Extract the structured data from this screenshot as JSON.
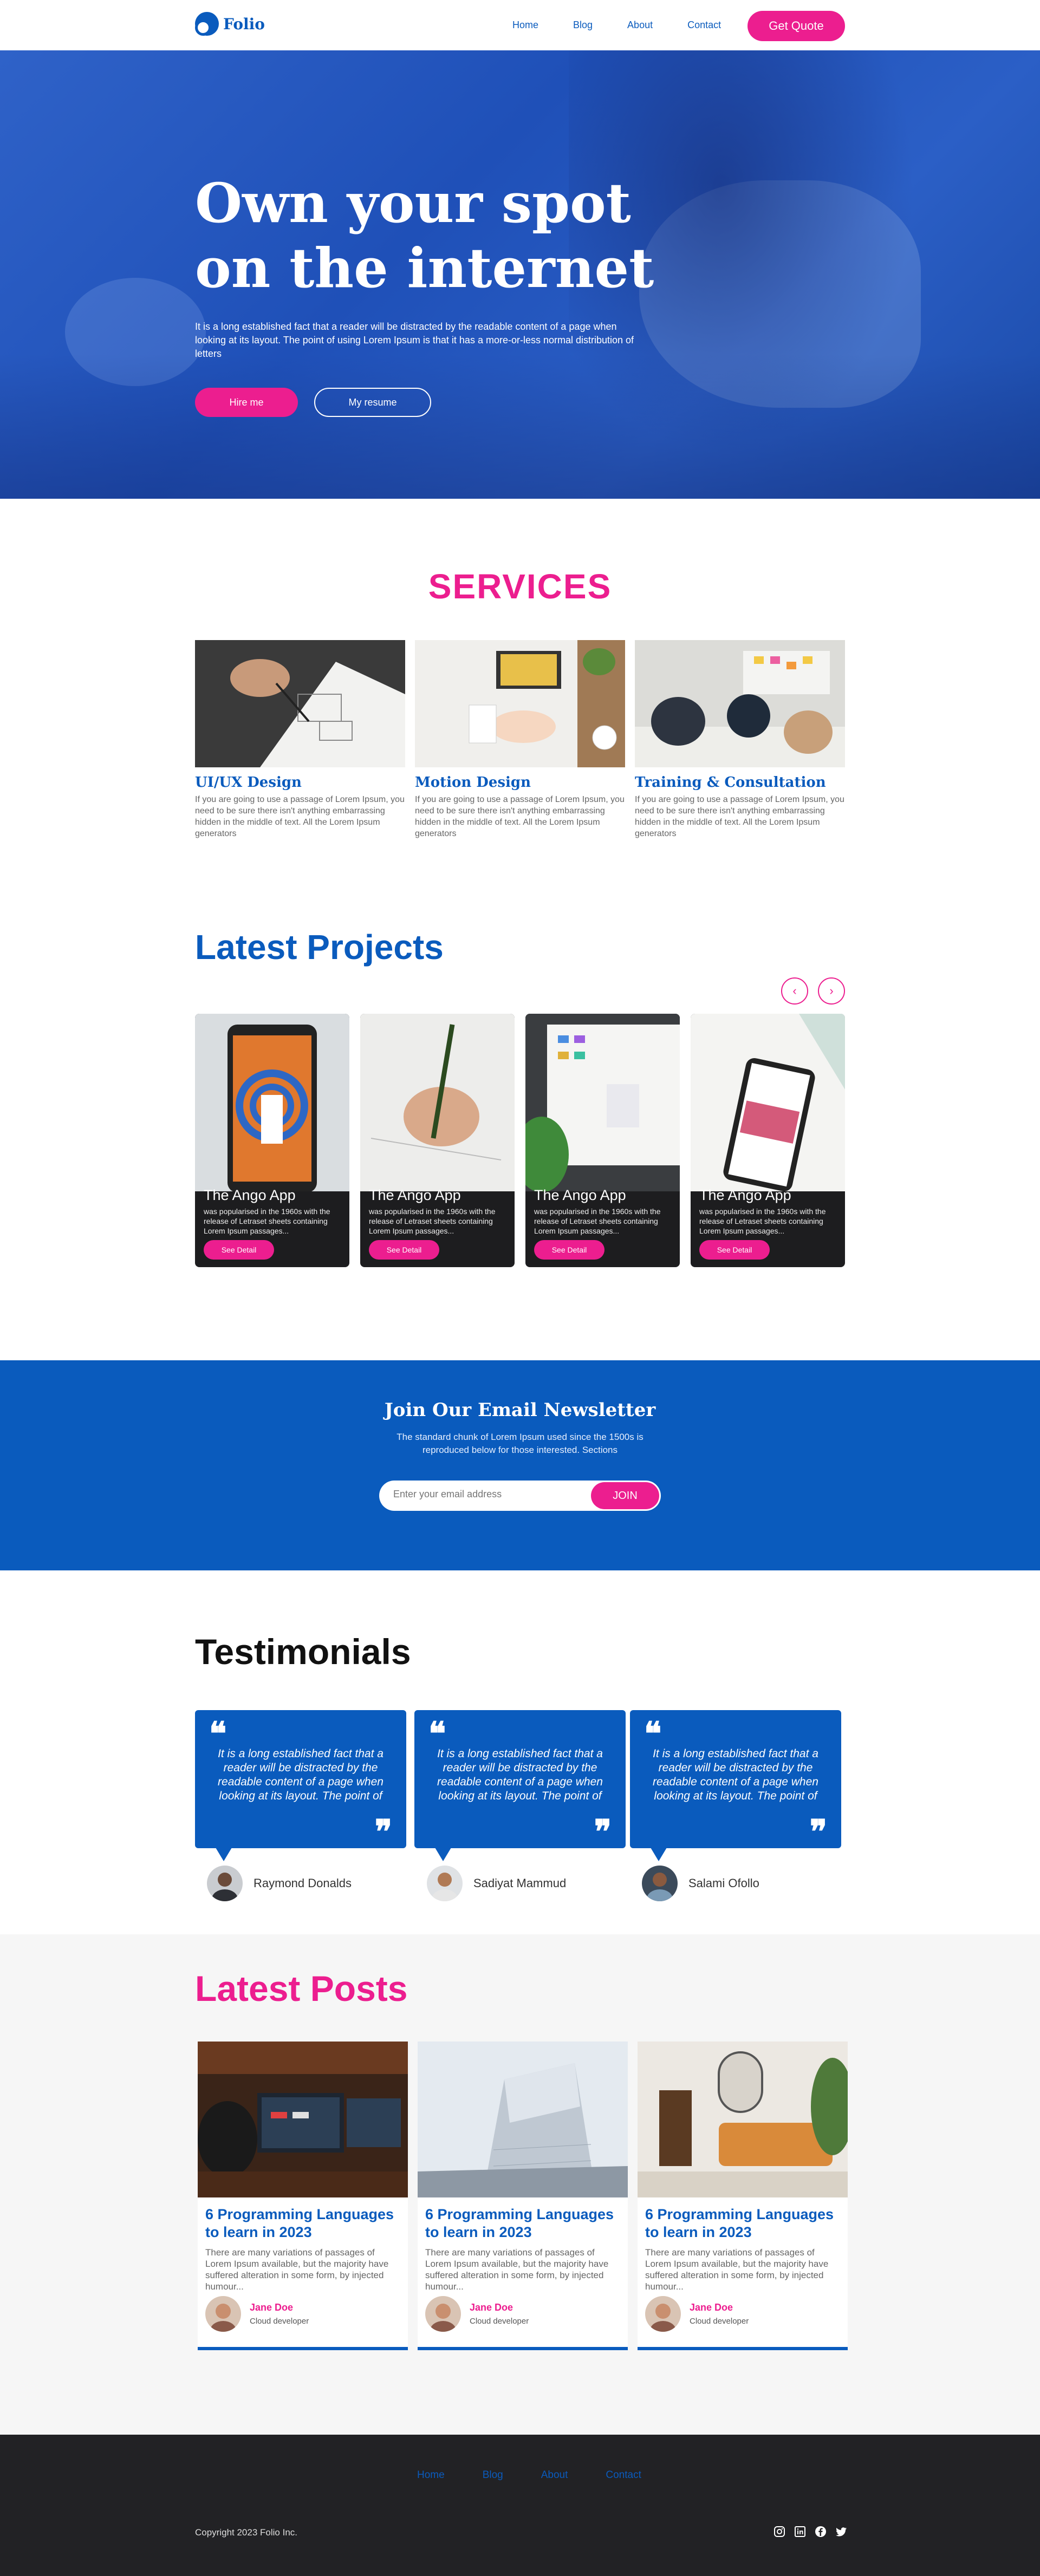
{
  "nav": {
    "logo": "Folio",
    "links": [
      "Home",
      "Blog",
      "About",
      "Contact"
    ],
    "cta": "Get Quote"
  },
  "hero": {
    "title": "Own your spot on the internet",
    "text": "It is a long established fact that a reader will be distracted by the readable content of a page when looking at its layout. The point of using Lorem Ipsum is that it has a more-or-less normal distribution of letters",
    "hire": "Hire me",
    "resume": "My resume"
  },
  "services": {
    "title": "SERVICES",
    "items": [
      {
        "title": "UI/UX Design",
        "text": "If you are going to use a passage of Lorem Ipsum, you need to be sure there isn't anything embarrassing hidden in the middle of text. All the Lorem Ipsum generators"
      },
      {
        "title": "Motion Design",
        "text": "If you are going to use a passage of Lorem Ipsum, you need to be sure there isn't anything embarrassing hidden in the middle of text. All the Lorem Ipsum generators"
      },
      {
        "title": "Training & Consultation",
        "text": "If you are going to use a passage of Lorem Ipsum, you need to be sure there isn't anything embarrassing hidden in the middle of text. All the Lorem Ipsum generators"
      }
    ]
  },
  "projects": {
    "title": "Latest Projects",
    "prev": "‹",
    "next": "›",
    "items": [
      {
        "name": "The Ango App",
        "text": "was popularised in the 1960s with the release of Letraset sheets containing Lorem Ipsum passages...",
        "button": "See Detail"
      },
      {
        "name": "The Ango App",
        "text": "was popularised in the 1960s with the release of Letraset sheets containing Lorem Ipsum passages...",
        "button": "See Detail"
      },
      {
        "name": "The Ango App",
        "text": "was popularised in the 1960s with the release of Letraset sheets containing Lorem Ipsum passages...",
        "button": "See Detail"
      },
      {
        "name": "The Ango App",
        "text": "was popularised in the 1960s with the release of Letraset sheets containing Lorem Ipsum passages...",
        "button": "See Detail"
      }
    ]
  },
  "newsletter": {
    "title": "Join Our Email Newsletter",
    "text": "The standard chunk of Lorem Ipsum used since the 1500s is reproduced below for those interested. Sections",
    "placeholder": "Enter your email address",
    "button": "JOIN"
  },
  "testimonials": {
    "title": "Testimonials",
    "items": [
      {
        "quote": "It is a long established fact that a reader will be distracted by the readable content of a page when looking at its layout. The point of",
        "name": "Raymond Donalds"
      },
      {
        "quote": "It is a long established fact that a reader will be distracted by the readable content of a page when looking at its layout. The point of",
        "name": "Sadiyat Mammud"
      },
      {
        "quote": "It is a long established fact that a reader will be distracted by the readable content of a page when looking at its layout. The point of",
        "name": "Salami Ofollo"
      }
    ]
  },
  "posts": {
    "title": "Latest Posts",
    "items": [
      {
        "title": "6 Programming Languages to learn in 2023",
        "text": "There are many variations of passages of Lorem Ipsum available, but the majority have suffered alteration in some form, by injected humour...",
        "author": "Jane Doe",
        "role": "Cloud developer"
      },
      {
        "title": "6 Programming Languages to learn in 2023",
        "text": "There are many variations of passages of Lorem Ipsum available, but the majority have suffered alteration in some form, by injected humour...",
        "author": "Jane Doe",
        "role": "Cloud developer"
      },
      {
        "title": "6 Programming Languages to learn in 2023",
        "text": "There are many variations of passages of Lorem Ipsum available, but the majority have suffered alteration in some form, by injected humour...",
        "author": "Jane Doe",
        "role": "Cloud developer"
      }
    ]
  },
  "footer": {
    "links": [
      "Home",
      "Blog",
      "About",
      "Contact"
    ],
    "copyright": "Copyright 2023 Folio Inc.",
    "socials": [
      "instagram-icon",
      "linkedin-icon",
      "facebook-icon",
      "twitter-icon"
    ]
  },
  "colors": {
    "primary": "#0a5bbd",
    "accent": "#ec1e8f",
    "footer_bg": "#222225"
  }
}
